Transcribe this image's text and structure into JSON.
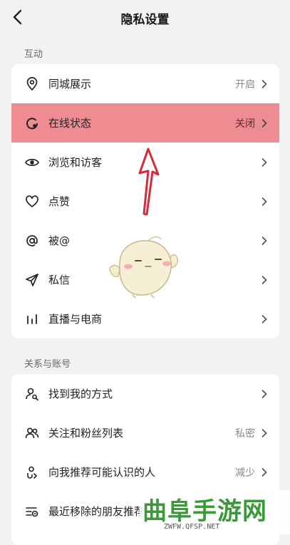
{
  "header": {
    "title": "隐私设置"
  },
  "sections": [
    {
      "label": "互动",
      "items": [
        {
          "label": "同城展示",
          "value": "开启",
          "icon": "location-pin-icon"
        },
        {
          "label": "在线状态",
          "value": "关闭",
          "icon": "online-status-icon",
          "highlighted": true
        },
        {
          "label": "浏览和访客",
          "value": "",
          "icon": "eye-icon"
        },
        {
          "label": "点赞",
          "value": "",
          "icon": "heart-icon"
        },
        {
          "label": "被@",
          "value": "",
          "icon": "at-sign-icon"
        },
        {
          "label": "私信",
          "value": "",
          "icon": "paper-plane-icon"
        },
        {
          "label": "直播与电商",
          "value": "",
          "icon": "bar-chart-icon"
        }
      ]
    },
    {
      "label": "关系与账号",
      "items": [
        {
          "label": "找到我的方式",
          "value": "",
          "icon": "user-search-icon"
        },
        {
          "label": "关注和粉丝列表",
          "value": "私密",
          "icon": "users-icon"
        },
        {
          "label": "向我推荐可能认识的人",
          "value": "减少",
          "icon": "user-recommend-icon"
        },
        {
          "label": "最近移除的朋友推荐",
          "value": "",
          "icon": "removed-list-icon"
        }
      ]
    }
  ],
  "watermark": {
    "title": "曲阜手游网",
    "url": "ZWFW.QFSP.NET"
  },
  "colors": {
    "highlight": "#ef8c92",
    "annotation_arrow": "#d42a3a",
    "background": "#f2f2f4"
  }
}
